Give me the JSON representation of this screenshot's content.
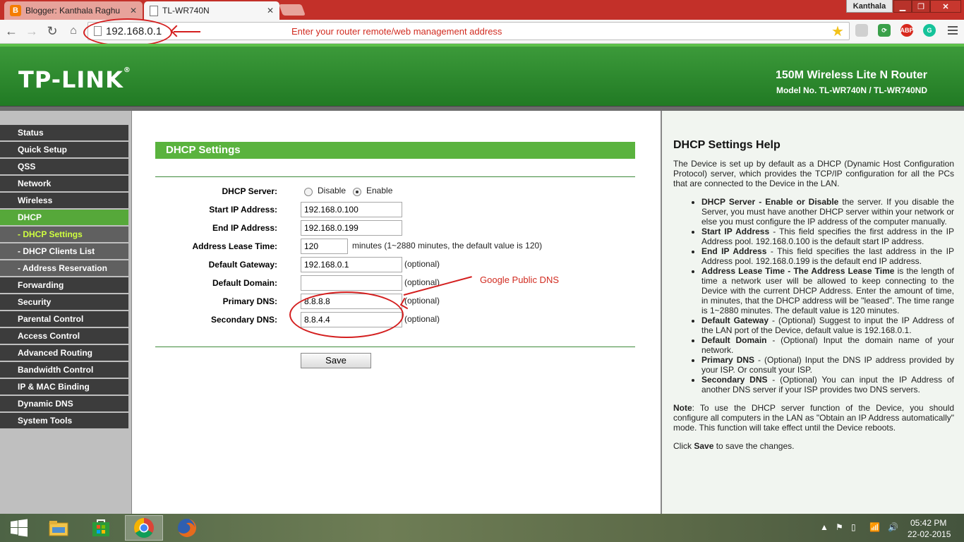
{
  "browser": {
    "tabs": [
      {
        "label": "Blogger: Kanthala Raghu",
        "active": false
      },
      {
        "label": "TL-WR740N",
        "active": true
      }
    ],
    "user_badge": "Kanthala",
    "url": "192.168.0.1",
    "url_annotation": "Enter your router remote/web management address",
    "extensions": [
      "bookmark-star",
      "extension-gray",
      "extension-green",
      "ABP",
      "grammarly"
    ]
  },
  "router": {
    "logo": "TP-LINK",
    "product_name": "150M Wireless Lite N Router",
    "model_no": "Model No. TL-WR740N / TL-WR740ND"
  },
  "menu": [
    {
      "label": "Status",
      "sub": false,
      "active": false
    },
    {
      "label": "Quick Setup",
      "sub": false,
      "active": false
    },
    {
      "label": "QSS",
      "sub": false,
      "active": false
    },
    {
      "label": "Network",
      "sub": false,
      "active": false
    },
    {
      "label": "Wireless",
      "sub": false,
      "active": false
    },
    {
      "label": "DHCP",
      "sub": false,
      "active": true
    },
    {
      "label": "- DHCP Settings",
      "sub": true,
      "active": true
    },
    {
      "label": "- DHCP Clients List",
      "sub": true,
      "active": false
    },
    {
      "label": "- Address Reservation",
      "sub": true,
      "active": false
    },
    {
      "label": "Forwarding",
      "sub": false,
      "active": false
    },
    {
      "label": "Security",
      "sub": false,
      "active": false
    },
    {
      "label": "Parental Control",
      "sub": false,
      "active": false
    },
    {
      "label": "Access Control",
      "sub": false,
      "active": false
    },
    {
      "label": "Advanced Routing",
      "sub": false,
      "active": false
    },
    {
      "label": "Bandwidth Control",
      "sub": false,
      "active": false
    },
    {
      "label": "IP & MAC Binding",
      "sub": false,
      "active": false
    },
    {
      "label": "Dynamic DNS",
      "sub": false,
      "active": false
    },
    {
      "label": "System Tools",
      "sub": false,
      "active": false
    }
  ],
  "form": {
    "title": "DHCP Settings",
    "dhcp_server_label": "DHCP Server:",
    "disable_label": "Disable",
    "enable_label": "Enable",
    "start_ip_label": "Start IP Address:",
    "start_ip": "192.168.0.100",
    "end_ip_label": "End IP Address:",
    "end_ip": "192.168.0.199",
    "lease_label": "Address Lease Time:",
    "lease": "120",
    "lease_note": "minutes (1~2880 minutes, the default value is 120)",
    "gateway_label": "Default Gateway:",
    "gateway": "192.168.0.1",
    "domain_label": "Default Domain:",
    "domain": "",
    "primary_dns_label": "Primary DNS:",
    "primary_dns": "8.8.8.8",
    "secondary_dns_label": "Secondary DNS:",
    "secondary_dns": "8.8.4.4",
    "optional": "(optional)",
    "save_label": "Save",
    "dns_annotation": "Google Public DNS"
  },
  "help": {
    "title": "DHCP Settings Help",
    "intro": "The Device is set up by default as a DHCP (Dynamic Host Configuration Protocol) server, which provides the TCP/IP configuration for all the PCs that are connected to the Device in the LAN.",
    "items": [
      {
        "term": "DHCP Server - Enable or Disable",
        "text": " the server. If you disable the Server, you must have another DHCP server within your network or else you must configure the IP address of the computer manually."
      },
      {
        "term": "Start IP Address",
        "text": " - This field specifies the first address in the IP Address pool. 192.168.0.100 is the default start IP address."
      },
      {
        "term": "End IP Address",
        "text": " - This field specifies the last address in the IP Address pool. 192.168.0.199 is the default end IP address."
      },
      {
        "term": "Address Lease Time - The Address Lease Time",
        "text": " is the length of time a network user will be allowed to keep connecting to the Device with the current DHCP Address. Enter the amount of time, in minutes, that the DHCP address will be \"leased\". The time range is 1~2880 minutes. The default value is 120 minutes."
      },
      {
        "term": "Default Gateway",
        "text": " - (Optional) Suggest to input the IP Address of the LAN port of the Device, default value is 192.168.0.1."
      },
      {
        "term": "Default Domain",
        "text": " - (Optional) Input the domain name of your network."
      },
      {
        "term": "Primary DNS",
        "text": " - (Optional) Input the DNS IP address provided by your ISP. Or consult your ISP."
      },
      {
        "term": "Secondary DNS",
        "text": " - (Optional) You can input the IP Address of another DNS server if your ISP provides two DNS servers."
      }
    ],
    "note_label": "Note",
    "note_text": ": To use the DHCP server function of the Device, you should configure all computers in the LAN as \"Obtain an IP Address automatically\" mode. This function will take effect until the Device reboots.",
    "click_text": "Click ",
    "click_bold": "Save",
    "click_after": " to save the changes."
  },
  "taskbar": {
    "time": "05:42 PM",
    "date": "22-02-2015"
  }
}
